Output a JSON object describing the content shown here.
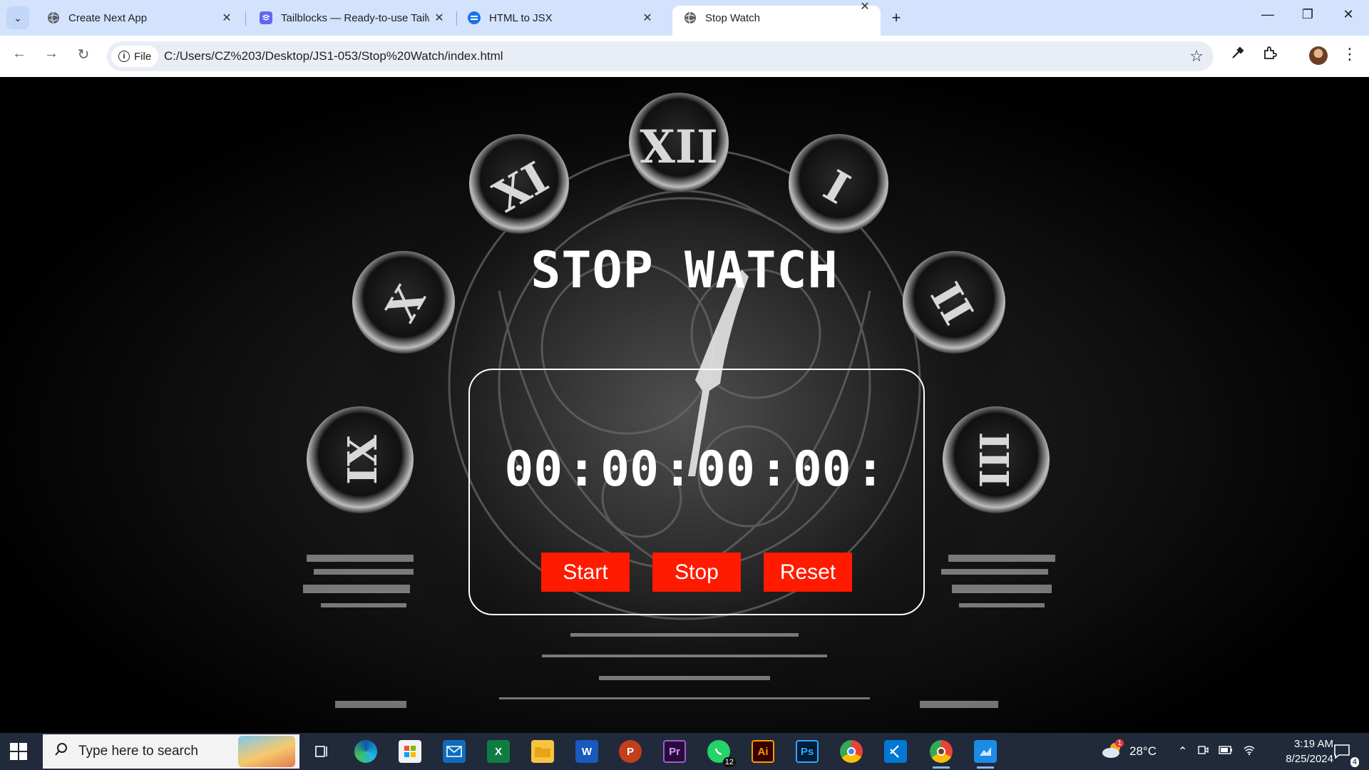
{
  "browser": {
    "tabs": [
      {
        "title": "Create Next App",
        "active": false,
        "icon": "globe-icon"
      },
      {
        "title": "Tailblocks — Ready-to-use Tailwind",
        "active": false,
        "icon": "tailblocks-icon"
      },
      {
        "title": "HTML to JSX",
        "active": false,
        "icon": "transform-icon"
      },
      {
        "title": "Stop Watch",
        "active": true,
        "icon": "globe-icon"
      }
    ],
    "address": {
      "chip_label": "File",
      "url": "C:/Users/CZ%203/Desktop/JS1-053/Stop%20Watch/index.html"
    }
  },
  "page": {
    "title": "STOP WATCH",
    "display": {
      "hours": "00",
      "minutes": "00",
      "seconds": "00",
      "milliseconds": "00",
      "separator": ":"
    },
    "buttons": {
      "start": "Start",
      "stop": "Stop",
      "reset": "Reset"
    },
    "button_color": "#ff1a00"
  },
  "taskbar": {
    "search_placeholder": "Type here to search",
    "apps": [
      {
        "name": "task-view-icon"
      },
      {
        "name": "edge-icon"
      },
      {
        "name": "store-icon"
      },
      {
        "name": "mail-icon"
      },
      {
        "name": "excel-icon",
        "label": "X"
      },
      {
        "name": "file-explorer-icon"
      },
      {
        "name": "word-icon",
        "label": "W"
      },
      {
        "name": "powerpoint-icon",
        "label": "P"
      },
      {
        "name": "premiere-icon",
        "label": "Pr"
      },
      {
        "name": "whatsapp-icon",
        "badge": "12"
      },
      {
        "name": "illustrator-icon",
        "label": "Ai"
      },
      {
        "name": "photoshop-icon",
        "label": "Ps"
      },
      {
        "name": "chrome-icon"
      },
      {
        "name": "vscode-icon"
      },
      {
        "name": "chrome-profile-icon"
      },
      {
        "name": "photos-icon"
      }
    ],
    "weather": {
      "temp": "28°C",
      "badge": "1"
    },
    "clock": {
      "time": "3:19 AM",
      "date": "8/25/2024"
    },
    "notifications_count": "4"
  }
}
